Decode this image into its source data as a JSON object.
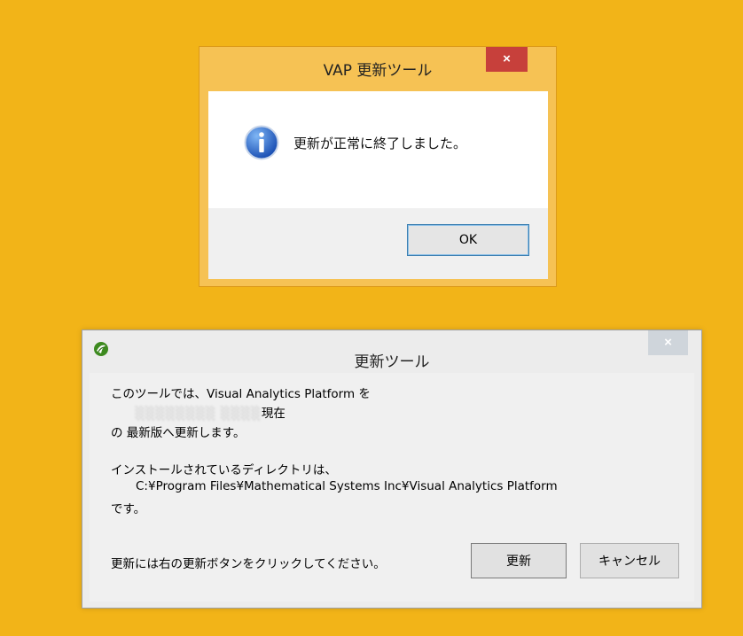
{
  "message_box": {
    "title": "VAP 更新ツール",
    "close_label": "×",
    "message": "更新が正常に終了しました。",
    "ok_label": "OK",
    "icon": "info-icon"
  },
  "update_tool": {
    "title": "更新ツール",
    "close_label": "×",
    "app_icon": "app-logo-icon",
    "line1": "このツールでは、Visual Analytics Platform を",
    "line2_blurred": "░░░░░░░░ ░░░░",
    "line2_suffix": "現在",
    "line3": "の 最新版へ更新します。",
    "line4": "インストールされているディレクトリは、",
    "path": "C:¥Program Files¥Mathematical Systems Inc¥Visual Analytics Platform",
    "line6": "です。",
    "instruction": "更新には右の更新ボタンをクリックしてください。",
    "update_label": "更新",
    "cancel_label": "キャンセル"
  },
  "colors": {
    "desktop": "#f2b418",
    "close_active": "#c7403b",
    "close_inactive": "#cfd5db"
  }
}
